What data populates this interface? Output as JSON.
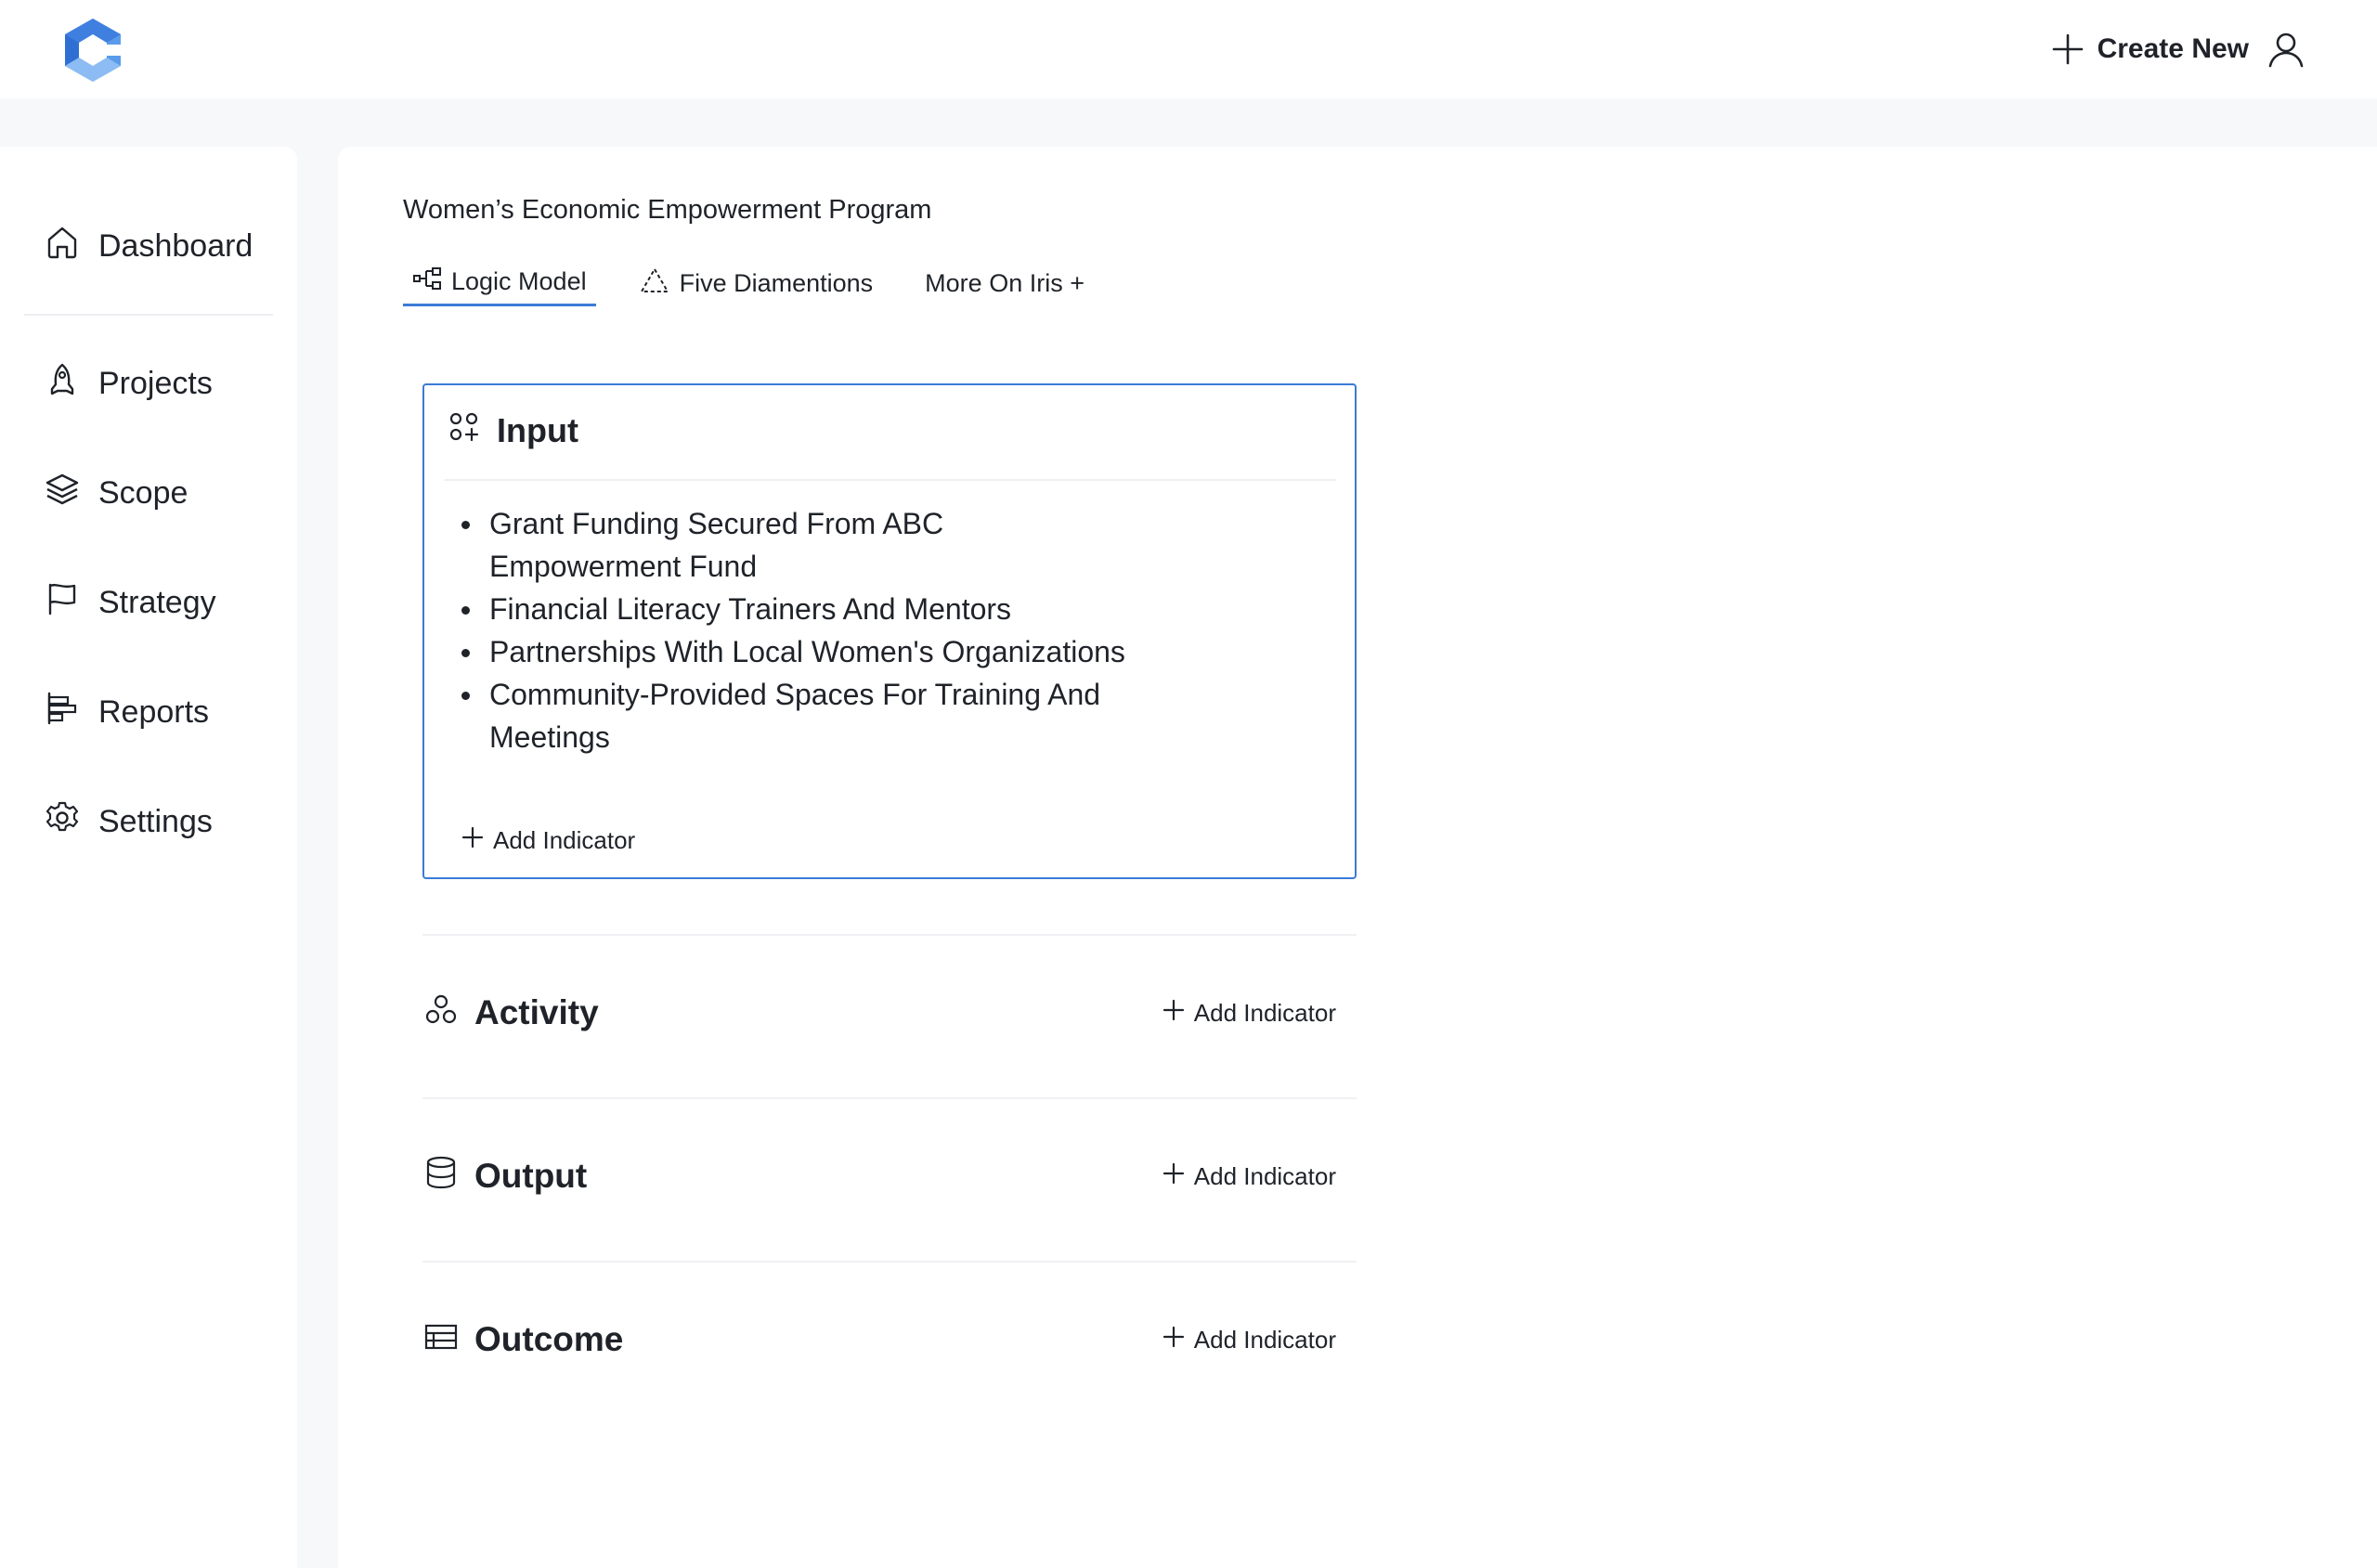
{
  "header": {
    "create_new_label": "Create New",
    "icons": [
      "logo-icon",
      "plus-icon",
      "user-icon"
    ]
  },
  "sidebar": {
    "items": [
      {
        "label": "Dashboard",
        "icon": "home-icon"
      },
      {
        "label": "Projects",
        "icon": "rocket-icon"
      },
      {
        "label": "Scope",
        "icon": "layers-icon"
      },
      {
        "label": "Strategy",
        "icon": "flag-icon"
      },
      {
        "label": "Reports",
        "icon": "bars-icon"
      },
      {
        "label": "Settings",
        "icon": "gear-icon"
      }
    ]
  },
  "main": {
    "program_title": "Women’s Economic Empowerment Program",
    "tabs": [
      {
        "label": "Logic Model",
        "icon": "hierarchy-icon",
        "active": true
      },
      {
        "label": "Five Diamentions",
        "icon": "triangle-icon",
        "active": false
      },
      {
        "label": "More On Iris +",
        "active": false
      }
    ],
    "input_card": {
      "title": "Input",
      "items": [
        "Grant Funding Secured From ABC Empowerment Fund",
        "Financial Literacy Trainers And Mentors",
        "Partnerships With Local Women's Organizations",
        "Community-Provided Spaces For Training And Meetings"
      ],
      "add_label": "Add Indicator"
    },
    "sections": [
      {
        "title": "Activity",
        "icon": "circles-icon",
        "add_label": "Add Indicator"
      },
      {
        "title": "Output",
        "icon": "database-icon",
        "add_label": "Add Indicator"
      },
      {
        "title": "Outcome",
        "icon": "table-icon",
        "add_label": "Add Indicator"
      }
    ]
  },
  "colors": {
    "accent": "#3b7bd6",
    "text": "#1f2329",
    "background": "#f7f8fa",
    "panel": "#ffffff"
  }
}
